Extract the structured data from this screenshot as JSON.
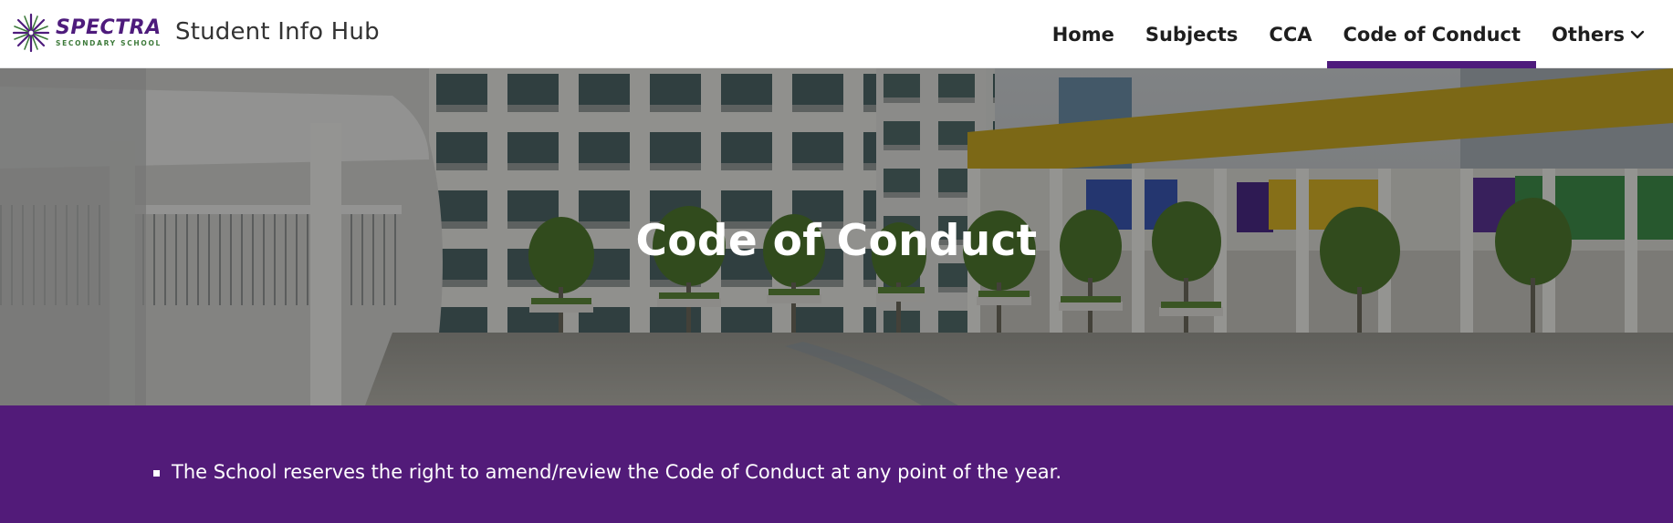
{
  "header": {
    "logo": {
      "word": "SPECTRA",
      "subtitle": "SECONDARY SCHOOL"
    },
    "site_title": "Student Info Hub"
  },
  "nav": {
    "items": [
      {
        "label": "Home",
        "active": false
      },
      {
        "label": "Subjects",
        "active": false
      },
      {
        "label": "CCA",
        "active": false
      },
      {
        "label": "Code of Conduct",
        "active": true
      },
      {
        "label": "Others",
        "active": false,
        "icon": "chevron-down-icon"
      }
    ]
  },
  "hero": {
    "title": "Code of Conduct"
  },
  "notice": {
    "items": [
      "The School reserves the right to amend/review the Code of Conduct at any point of the year."
    ]
  },
  "colors": {
    "brand_purple": "#521b79",
    "logo_green": "#3d7a3a",
    "nav_text": "#1e1e1e"
  }
}
